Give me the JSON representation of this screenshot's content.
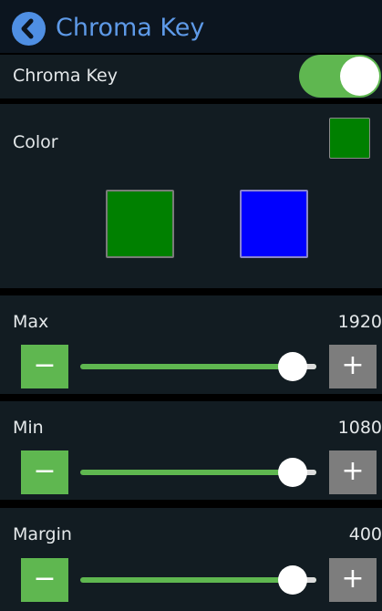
{
  "header": {
    "title": "Chroma Key",
    "back_icon": "chevron-left-icon"
  },
  "chroma_key": {
    "label": "Chroma Key",
    "enabled": true
  },
  "color": {
    "label": "Color",
    "current": "#008000",
    "options": [
      "#008000",
      "#0000ff"
    ]
  },
  "sliders": [
    {
      "id": "max",
      "label": "Max",
      "value": "1920",
      "level": 0.9
    },
    {
      "id": "min",
      "label": "Min",
      "value": "1080",
      "level": 0.9
    },
    {
      "id": "margin",
      "label": "Margin",
      "value": "400",
      "level": 0.9
    }
  ],
  "buttons": {
    "minus": "−",
    "plus": "+"
  },
  "colors": {
    "accent": "#5fb750",
    "header_text": "#5e9ae8",
    "panel": "#121c22"
  }
}
